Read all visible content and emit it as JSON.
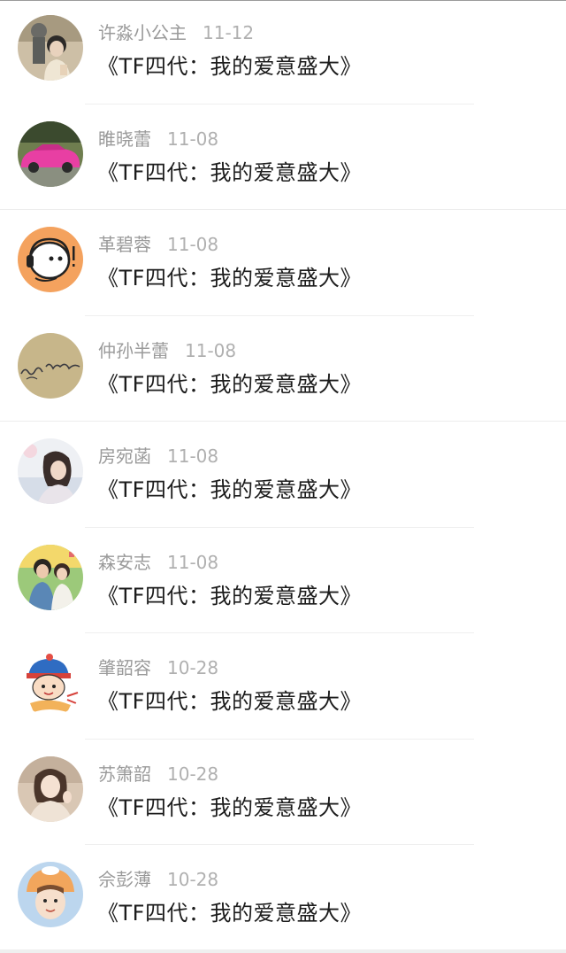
{
  "comments": [
    {
      "username": "许淼小公主",
      "date": "11-12",
      "text": "《TF四代：我的爱意盛大》",
      "avatar": "avatar-photo-girl-icon"
    },
    {
      "username": "睢晓蕾",
      "date": "11-08",
      "text": "《TF四代：我的爱意盛大》",
      "avatar": "avatar-pink-car-icon"
    },
    {
      "username": "革碧蓉",
      "date": "11-08",
      "text": "《TF四代：我的爱意盛大》",
      "avatar": "avatar-cartoon-headphones-icon"
    },
    {
      "username": "仲孙半蕾",
      "date": "11-08",
      "text": "《TF四代：我的爱意盛大》",
      "avatar": "avatar-handwriting-icon"
    },
    {
      "username": "房宛菡",
      "date": "11-08",
      "text": "《TF四代：我的爱意盛大》",
      "avatar": "avatar-photo-woman-icon"
    },
    {
      "username": "森安志",
      "date": "11-08",
      "text": "《TF四代：我的爱意盛大》",
      "avatar": "avatar-photo-couple-icon"
    },
    {
      "username": "肇韶容",
      "date": "10-28",
      "text": "《TF四代：我的爱意盛大》",
      "avatar": "avatar-cartoon-hat-icon"
    },
    {
      "username": "苏箫韶",
      "date": "10-28",
      "text": "《TF四代：我的爱意盛大》",
      "avatar": "avatar-photo-girl-pose-icon"
    },
    {
      "username": "佘彭薄",
      "date": "10-28",
      "text": "《TF四代：我的爱意盛大》",
      "avatar": "avatar-photo-child-hat-icon"
    }
  ]
}
